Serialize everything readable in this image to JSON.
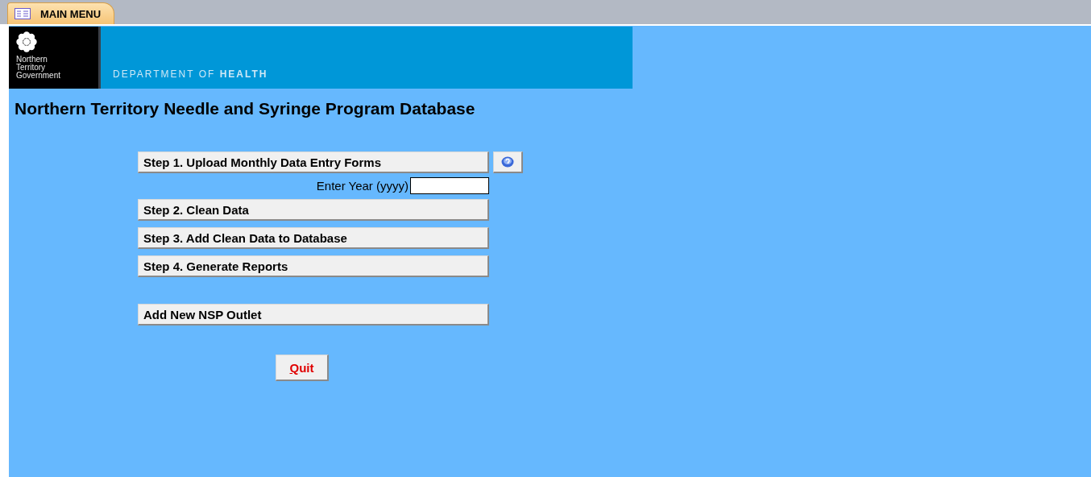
{
  "tab": {
    "label": "MAIN MENU",
    "selected": true
  },
  "banner": {
    "logo_lines": [
      "Northern",
      "Territory",
      "Government"
    ],
    "department_prefix": "DEPARTMENT OF",
    "department_bold": "HEALTH"
  },
  "title": "Northern Territory Needle and Syringe Program Database",
  "step1": {
    "label": "Step 1. Upload Monthly Data Entry Forms"
  },
  "year_field": {
    "label": "Enter Year (yyyy)"
  },
  "steps": [
    {
      "label": "Step 2. Clean Data"
    },
    {
      "label": "Step 3. Add Clean Data to Database"
    },
    {
      "label": "Step 4. Generate Reports"
    }
  ],
  "outlet_button": {
    "label": "Add New NSP Outlet"
  },
  "quit_button": {
    "label": "Quit"
  }
}
